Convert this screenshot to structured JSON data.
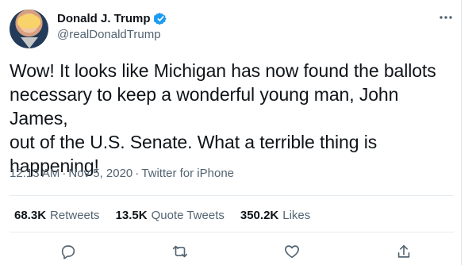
{
  "profile": {
    "display_name": "Donald J. Trump",
    "handle": "@realDonaldTrump",
    "avatar_icon": "profile-photo",
    "verified_icon": "verified-badge-icon",
    "more_icon": "more-options-icon"
  },
  "tweet": {
    "text": "Wow! It looks like Michigan has now found the ballots\nnecessary to keep a wonderful young man, John James,\nout of the U.S. Senate. What a terrible thing is\nhappening!",
    "time": "12:13 AM",
    "separator_1": "·",
    "date": "Nov 5, 2020",
    "separator_2": "·",
    "source": "Twitter for iPhone"
  },
  "stats": {
    "retweets_count": "68.3K",
    "retweets_label": "Retweets",
    "quote_tweets_count": "13.5K",
    "quote_tweets_label": "Quote Tweets",
    "likes_count": "350.2K",
    "likes_label": "Likes"
  },
  "actions": {
    "reply_icon": "reply-icon",
    "retweet_icon": "retweet-icon",
    "like_icon": "like-icon",
    "share_icon": "share-icon"
  },
  "colors": {
    "text": "#0f1419",
    "secondary_text": "#536471",
    "verified": "#1d9bf0",
    "divider": "#e6ecf0"
  }
}
